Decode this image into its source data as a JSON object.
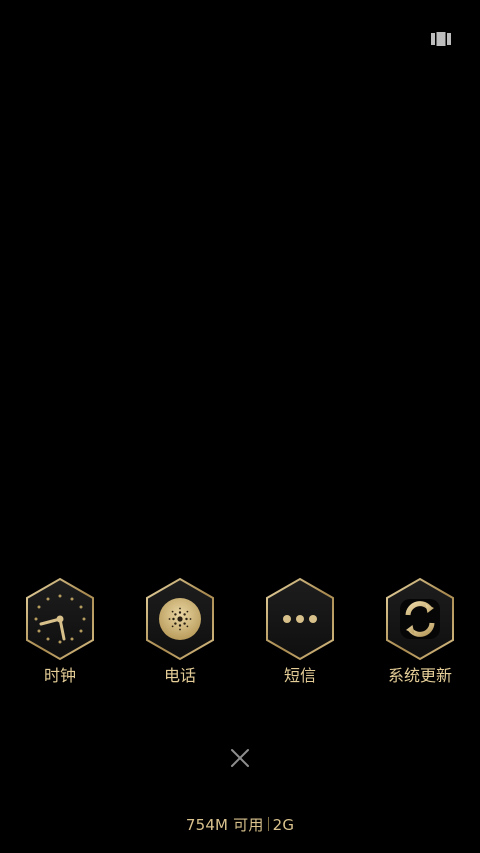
{
  "top_right_icon": "recent-apps-icon",
  "apps": [
    {
      "name": "clock",
      "label": "时钟",
      "icon": "clock-icon"
    },
    {
      "name": "phone",
      "label": "电话",
      "icon": "phone-icon"
    },
    {
      "name": "sms",
      "label": "短信",
      "icon": "message-icon"
    },
    {
      "name": "system-update",
      "label": "系统更新",
      "icon": "system-update-icon"
    }
  ],
  "close_button": {
    "icon": "close-icon"
  },
  "memory": {
    "available": "754M 可用",
    "total": "2G"
  },
  "colors": {
    "background": "#000000",
    "gold": "#d6bf86",
    "hex_fill": "#161616",
    "hex_border": "#b49a5f"
  }
}
